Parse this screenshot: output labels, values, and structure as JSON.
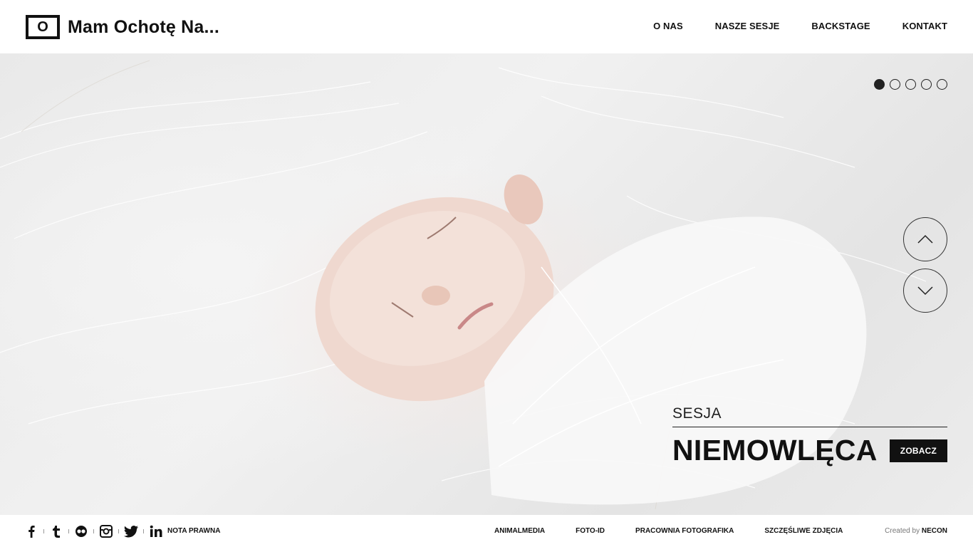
{
  "header": {
    "logo_mark": "O",
    "logo_text": "Mam Ochotę Na...",
    "nav": [
      "O NAS",
      "NASZE SESJE",
      "BACKSTAGE",
      "KONTAKT"
    ]
  },
  "slider": {
    "dots_count": 5,
    "active_index": 0,
    "caption_small": "SESJA",
    "caption_big": "NIEMOWLĘCA",
    "cta_label": "ZOBACZ"
  },
  "footer": {
    "social_icons": [
      "facebook-icon",
      "tumblr-icon",
      "flickr-icon",
      "instagram-icon",
      "twitter-icon",
      "linkedin-icon"
    ],
    "nota": "NOTA PRAWNA",
    "links": [
      "ANIMALMEDIA",
      "FOTO-ID",
      "PRACOWNIA FOTOGRAFIKA",
      "SZCZĘŚLIWE ZDJĘCIA"
    ],
    "credit_prefix": "Created by",
    "credit_name": "NECON"
  },
  "colors": {
    "text": "#111111",
    "button_bg": "#111111",
    "button_text": "#ffffff"
  }
}
